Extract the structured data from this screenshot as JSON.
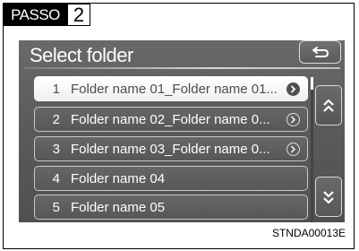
{
  "header": {
    "brand": "PASSO",
    "step": "2"
  },
  "screen": {
    "title": "Select folder",
    "back_icon": "return-arrow-icon",
    "folders": [
      {
        "num": "1",
        "label": "Folder name 01_Folder name 01...",
        "selected": true,
        "has_more": true
      },
      {
        "num": "2",
        "label": "Folder name 02_Folder name 0...",
        "selected": false,
        "has_more": true
      },
      {
        "num": "3",
        "label": "Folder name 03_Folder name 0...",
        "selected": false,
        "has_more": true
      },
      {
        "num": "4",
        "label": "Folder name 04",
        "selected": false,
        "has_more": false
      },
      {
        "num": "5",
        "label": "Folder name 05",
        "selected": false,
        "has_more": false
      }
    ],
    "page_up_icon": "double-chevron-up-icon",
    "page_down_icon": "double-chevron-down-icon"
  },
  "caption": "STNDA00013E",
  "colors": {
    "screen_bg": "#5c5c5c",
    "selected_row": "#ffffff",
    "text": "#ffffff"
  }
}
